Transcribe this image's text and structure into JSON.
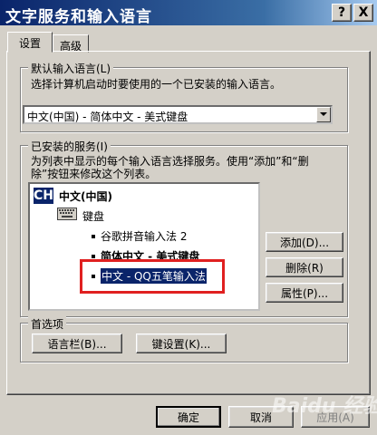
{
  "window": {
    "title": "文字服务和输入语言",
    "help_glyph": "?",
    "close_glyph": "X"
  },
  "tabs": [
    {
      "label": "设置"
    },
    {
      "label": "高级"
    }
  ],
  "default_language": {
    "legend": "默认输入语言(L)",
    "description": "选择计算机启动时要使用的一个已安装的输入语言。",
    "selected": "中文(中国) - 简体中文 - 美式键盘"
  },
  "installed_services": {
    "legend": "已安装的服务(I)",
    "description_line1": "为列表中显示的每个输入语言选择服务。使用“添加”和“删",
    "description_line2": "除”按钮来修改这个列表。",
    "tree": {
      "language_badge": "CH",
      "language": "中文(中国)",
      "category": "键盘",
      "items": [
        "谷歌拼音输入法 2",
        "简体中文 - 美式键盘",
        "中文 - QQ五笔输入法"
      ]
    },
    "buttons": {
      "add": "添加(D)...",
      "remove": "删除(R)",
      "properties": "属性(P)..."
    }
  },
  "preferences": {
    "legend": "首选项",
    "language_bar": "语言栏(B)...",
    "key_settings": "键设置(K)..."
  },
  "footer": {
    "ok": "确定",
    "cancel": "取消",
    "apply": "应用(A)"
  },
  "watermark": "Baidu 经验"
}
